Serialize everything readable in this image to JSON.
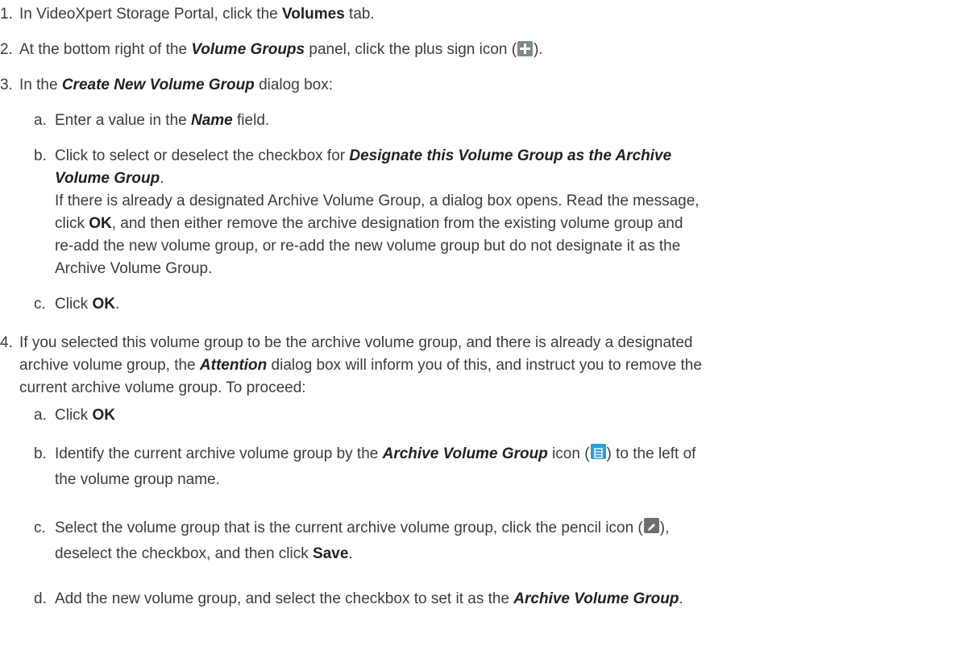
{
  "steps": {
    "s1": {
      "num": "1.",
      "a": "In VideoXpert Storage Portal, click the ",
      "b": "Volumes",
      "c": " tab."
    },
    "s2": {
      "num": "2.",
      "a": "At the bottom right of the ",
      "em": "Volume Groups",
      "b": " panel, click the plus sign icon (",
      "c": ")."
    },
    "s3": {
      "num": "3.",
      "a": "In the ",
      "em": "Create New Volume Group",
      "b": " dialog box:"
    },
    "s3a": {
      "letter": "a.",
      "a": "Enter a value in the ",
      "em": "Name",
      "b": " field."
    },
    "s3b": {
      "letter": "b.",
      "a": "Click to select or deselect the checkbox for ",
      "em1": "Designate this Volume Group as the Archive",
      "em2": "Volume Group",
      "b": ".",
      "l2a": "If there is already a designated Archive Volume Group, a dialog box opens. Read the message,",
      "l3a": "click ",
      "l3b": "OK",
      "l3c": ", and then either remove the archive designation from the existing volume group and",
      "l4": "re-add the new volume group, or re-add the new volume group but do not designate it as the",
      "l5": "Archive Volume Group."
    },
    "s3c": {
      "letter": "c.",
      "a": "Click ",
      "b": "OK",
      "c": "."
    },
    "s4": {
      "num": "4.",
      "l1": "If you selected this volume group to be the archive volume group, and there is already a designated",
      "l2a": "archive volume group, the ",
      "l2em": "Attention",
      "l2b": " dialog box will inform you of this, and instruct you to remove the",
      "l3": "current archive volume group. To proceed:"
    },
    "s4a": {
      "letter": "a.",
      "a": "Click ",
      "b": "OK"
    },
    "s4b": {
      "letter": "b.",
      "a": "Identify the current archive volume group by the ",
      "em": "Archive Volume Group",
      "b": " icon (",
      "c": ") to the left of",
      "l2": "the volume group name."
    },
    "s4c": {
      "letter": "c.",
      "a": "Select the volume group that is the current archive volume group, click the pencil icon (",
      "b": "),",
      "l2a": "deselect the checkbox, and then click ",
      "l2b": "Save",
      "l2c": "."
    },
    "s4d": {
      "letter": "d.",
      "a": "Add the new volume group, and select the checkbox to set it as the ",
      "em": "Archive Volume Group",
      "b": "."
    }
  },
  "icons": {
    "plus": "plus-icon",
    "archive": "archive-volume-group-icon",
    "pencil": "pencil-icon"
  },
  "colors": {
    "plus_icon": "#7f8a92",
    "archive_icon": "#2a9fd8",
    "pencil_icon": "#6f6f6f"
  }
}
